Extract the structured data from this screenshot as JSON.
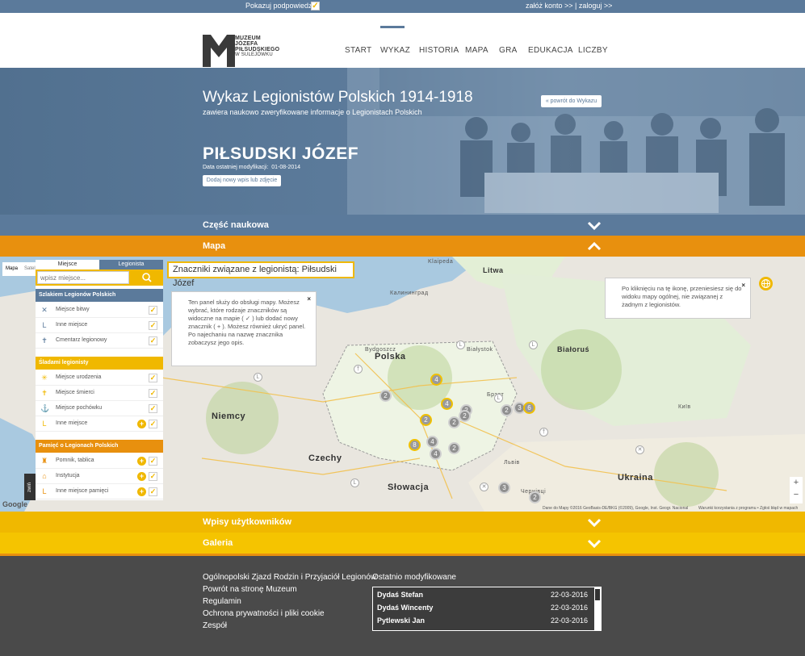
{
  "topbar": {
    "hints_label": "Pokazuj podpowiedzi",
    "hints_checked": "✓",
    "account_links": "załóż konto >> | zaloguj >>"
  },
  "logo": {
    "line1": "MUZEUM",
    "line2": "JÓZEFA",
    "line3": "PIŁSUDSKIEGO",
    "line4": "W SULEJÓWKU"
  },
  "nav": {
    "items": [
      "START",
      "WYKAZ",
      "HISTORIA",
      "MAPA",
      "GRA",
      "EDUKACJA",
      "LICZBY"
    ],
    "active": "WYKAZ"
  },
  "hero": {
    "title": "Wykaz Legionistów Polskich 1914-1918",
    "subtitle": "zawiera naukowo zweryfikowane informacje o Legionistach Polskich",
    "back_button": "« powrót do Wykazu",
    "person_name": "PIŁSUDSKI JÓZEF",
    "modified_label": "Data ostatniej modyfikacji:",
    "modified_date": "01-08-2014",
    "add_button": "Dodaj nowy wpis lub zdjęcie >>"
  },
  "sections": {
    "scientific": "Część naukowa",
    "map": "Mapa",
    "user_entries": "Wpisy użytkowników",
    "gallery": "Galeria"
  },
  "colors": {
    "slate": "#5b7a9b",
    "orange": "#e8900e",
    "yellow": "#f0b800",
    "footer": "#4a4a4a"
  },
  "map": {
    "type_options": [
      "Mapa",
      "Satelita"
    ],
    "tabs": [
      "Miejsce",
      "Legionista"
    ],
    "search_placeholder": "wpisz miejsce...",
    "groups": [
      {
        "title": "Szlakiem Legionów Polskich",
        "color": "#5b7a9b",
        "items": [
          {
            "label": "Miejsce bitwy",
            "icon": "crossed-swords-icon",
            "glyph": "✕",
            "plus": false
          },
          {
            "label": "Inne miejsce",
            "icon": "legion-l-icon",
            "glyph": "L",
            "plus": false
          },
          {
            "label": "Cmentarz legionowy",
            "icon": "cemetery-cross-icon",
            "glyph": "✝",
            "plus": false
          }
        ]
      },
      {
        "title": "Śladami legionisty",
        "color": "#f0b800",
        "items": [
          {
            "label": "Miejsce urodzenia",
            "icon": "birth-star-icon",
            "glyph": "✳",
            "plus": false
          },
          {
            "label": "Miejsce śmierci",
            "icon": "death-cross-icon",
            "glyph": "✝",
            "plus": false
          },
          {
            "label": "Miejsce pochówku",
            "icon": "burial-icon",
            "glyph": "⚓",
            "plus": false
          },
          {
            "label": "Inne miejsce",
            "icon": "legion-l-icon",
            "glyph": "L",
            "plus": true
          }
        ]
      },
      {
        "title": "Pamięć o Legionach Polskich",
        "color": "#e8900e",
        "items": [
          {
            "label": "Pomnik, tablica",
            "icon": "monument-icon",
            "glyph": "♜",
            "plus": true
          },
          {
            "label": "Instytucja",
            "icon": "institution-icon",
            "glyph": "⌂",
            "plus": true
          },
          {
            "label": "Inne miejsce pamięci",
            "icon": "legion-l-icon",
            "glyph": "L",
            "plus": true
          }
        ]
      }
    ],
    "collapse_label": "zwiń",
    "title_box": "Znaczniki związane z legionistą: Piłsudski Józef",
    "tip_left": "Ten panel służy do obsługi mapy. Możesz wybrać, które rodzaje znaczników są widoczne na mapie ( ✓ ) lub dodać nowy znacznik ( + ). Możesz również ukryć panel. Po najechaniu na nazwę znacznika zobaczysz jego opis.",
    "tip_right": "Po kliknięciu na tę ikonę, przeniesiesz się do widoku mapy ogólnej, nie związanej z żadnym z legionistów.",
    "tip_close": "×",
    "labels": {
      "polska": "Polska",
      "niemcy": "Niemcy",
      "czechy": "Czechy",
      "slowacja": "Słowacja",
      "ukraina": "Ukraina",
      "bialorus": "Białoruś",
      "litwa": "Litwa",
      "klaipeda": "Klaipeda",
      "kaliningrad": "Калининград",
      "bydgoszcz": "Bydgoszcz",
      "bialystok": "Białystok",
      "brest": "Брэст",
      "lwow": "Львів",
      "kyiv": "Київ",
      "chernivtsi": "Чернівці"
    },
    "clusters": [
      "4",
      "2",
      "4",
      "2",
      "2",
      "2",
      "3",
      "2",
      "6",
      "8",
      "4",
      "2",
      "4",
      "3",
      "2",
      "2"
    ],
    "footnote_left": "Dane do Mapy ©2016 GeoBasis-DE/BKG (©2009), Google, Inst. Geogr. Nacional",
    "footnote_right": "Warunki korzystania z programu • Zgłoś błąd w mapach",
    "zoom_in": "+",
    "zoom_out": "−",
    "google": "Google"
  },
  "footer": {
    "links": [
      "Ogólnopolski Zjazd Rodzin i Przyjaciół Legionów",
      "Powrót na stronę Muzeum",
      "Regulamin",
      "Ochrona prywatności i pliki cookie",
      "Zespół"
    ],
    "recent_title": "Ostatnio modyfikowane",
    "recent": [
      {
        "name": "Dydaś Stefan",
        "date": "22-03-2016"
      },
      {
        "name": "Dydaś Wincenty",
        "date": "22-03-2016"
      },
      {
        "name": "Pytlewski Jan",
        "date": "22-03-2016"
      }
    ]
  }
}
